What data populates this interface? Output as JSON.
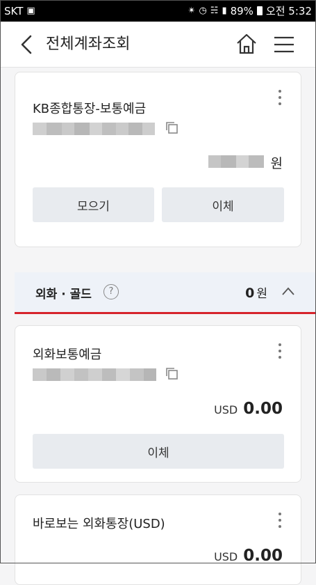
{
  "statusbar": {
    "carrier": "SKT",
    "battery": "89%",
    "time": "오전 5:32"
  },
  "header": {
    "title": "전체계좌조회"
  },
  "accounts": [
    {
      "name": "KB종합통장-보통예금",
      "balance_unit": "원",
      "buttons": [
        "모으기",
        "이체"
      ]
    }
  ],
  "section": {
    "title": "외화 · 골드",
    "help": "?",
    "amount": "0",
    "unit": "원"
  },
  "fx_accounts": [
    {
      "name": "외화보통예금",
      "currency": "USD",
      "amount": "0.00",
      "button": "이체"
    },
    {
      "name": "바로보는 외화통장(USD)",
      "currency": "USD",
      "amount": "0.00"
    }
  ]
}
